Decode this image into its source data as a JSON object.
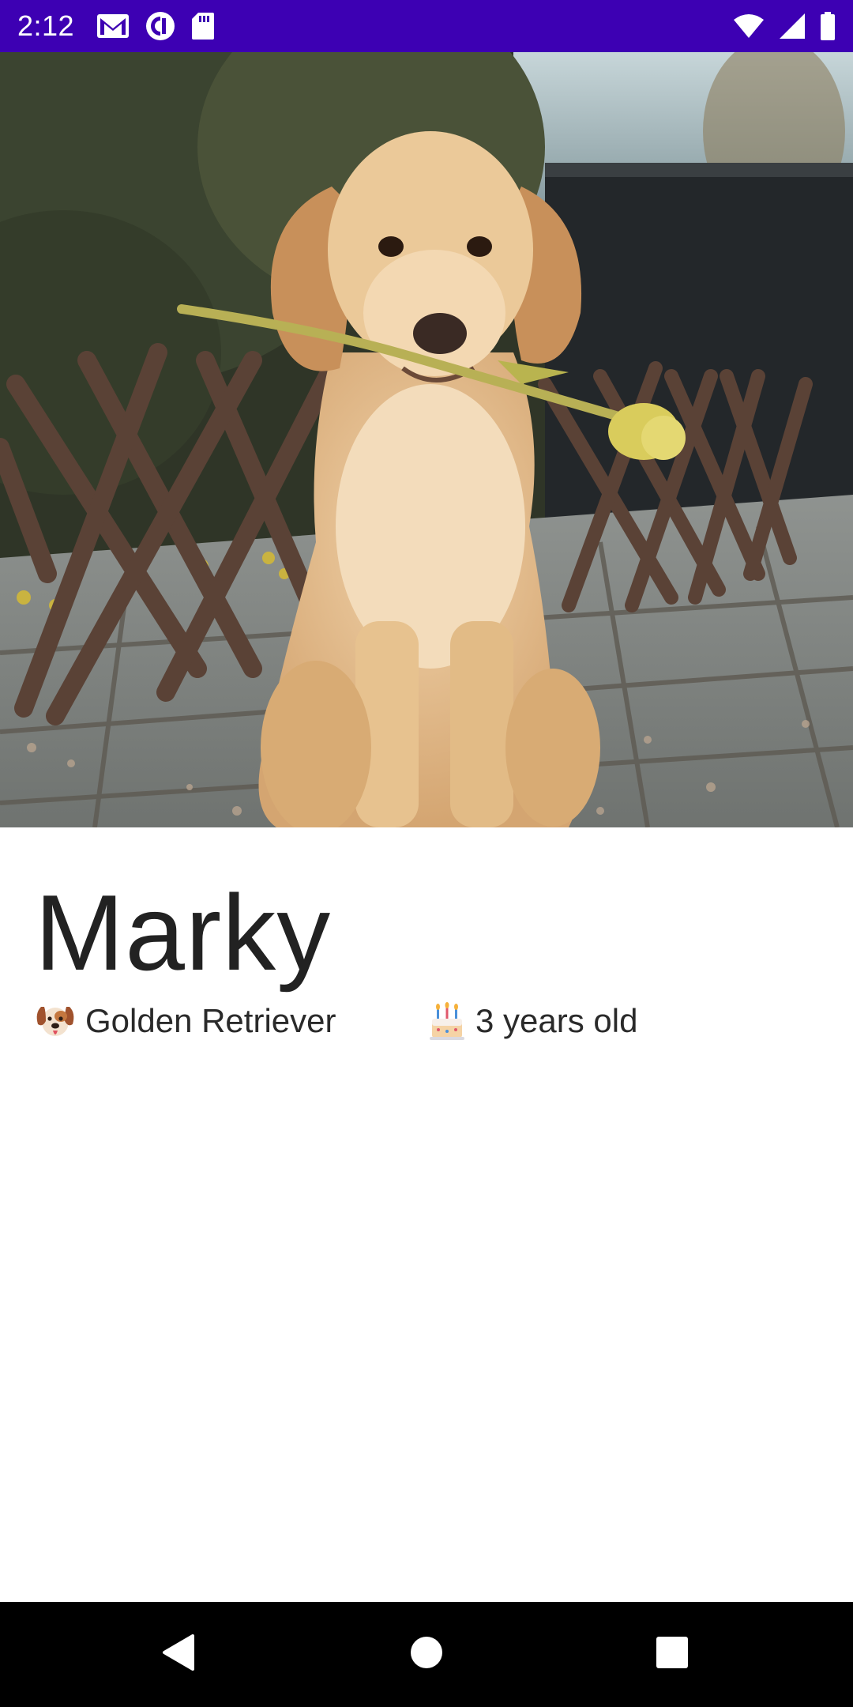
{
  "status_bar": {
    "time": "2:12",
    "left_icons": [
      "gmail-icon",
      "pocket-casts-icon",
      "sd-card-icon"
    ],
    "right_icons": [
      "wifi-icon",
      "cell-signal-icon",
      "battery-icon"
    ],
    "background_color": "#3d00b3"
  },
  "pet": {
    "name": "Marky",
    "breed_icon": "dog-face-icon",
    "breed": "Golden Retriever",
    "age_icon": "birthday-cake-icon",
    "age": "3 years old",
    "photo_icon": "dog-photo-icon"
  },
  "nav_bar": {
    "buttons": [
      "back-icon",
      "home-icon",
      "recents-icon"
    ]
  }
}
